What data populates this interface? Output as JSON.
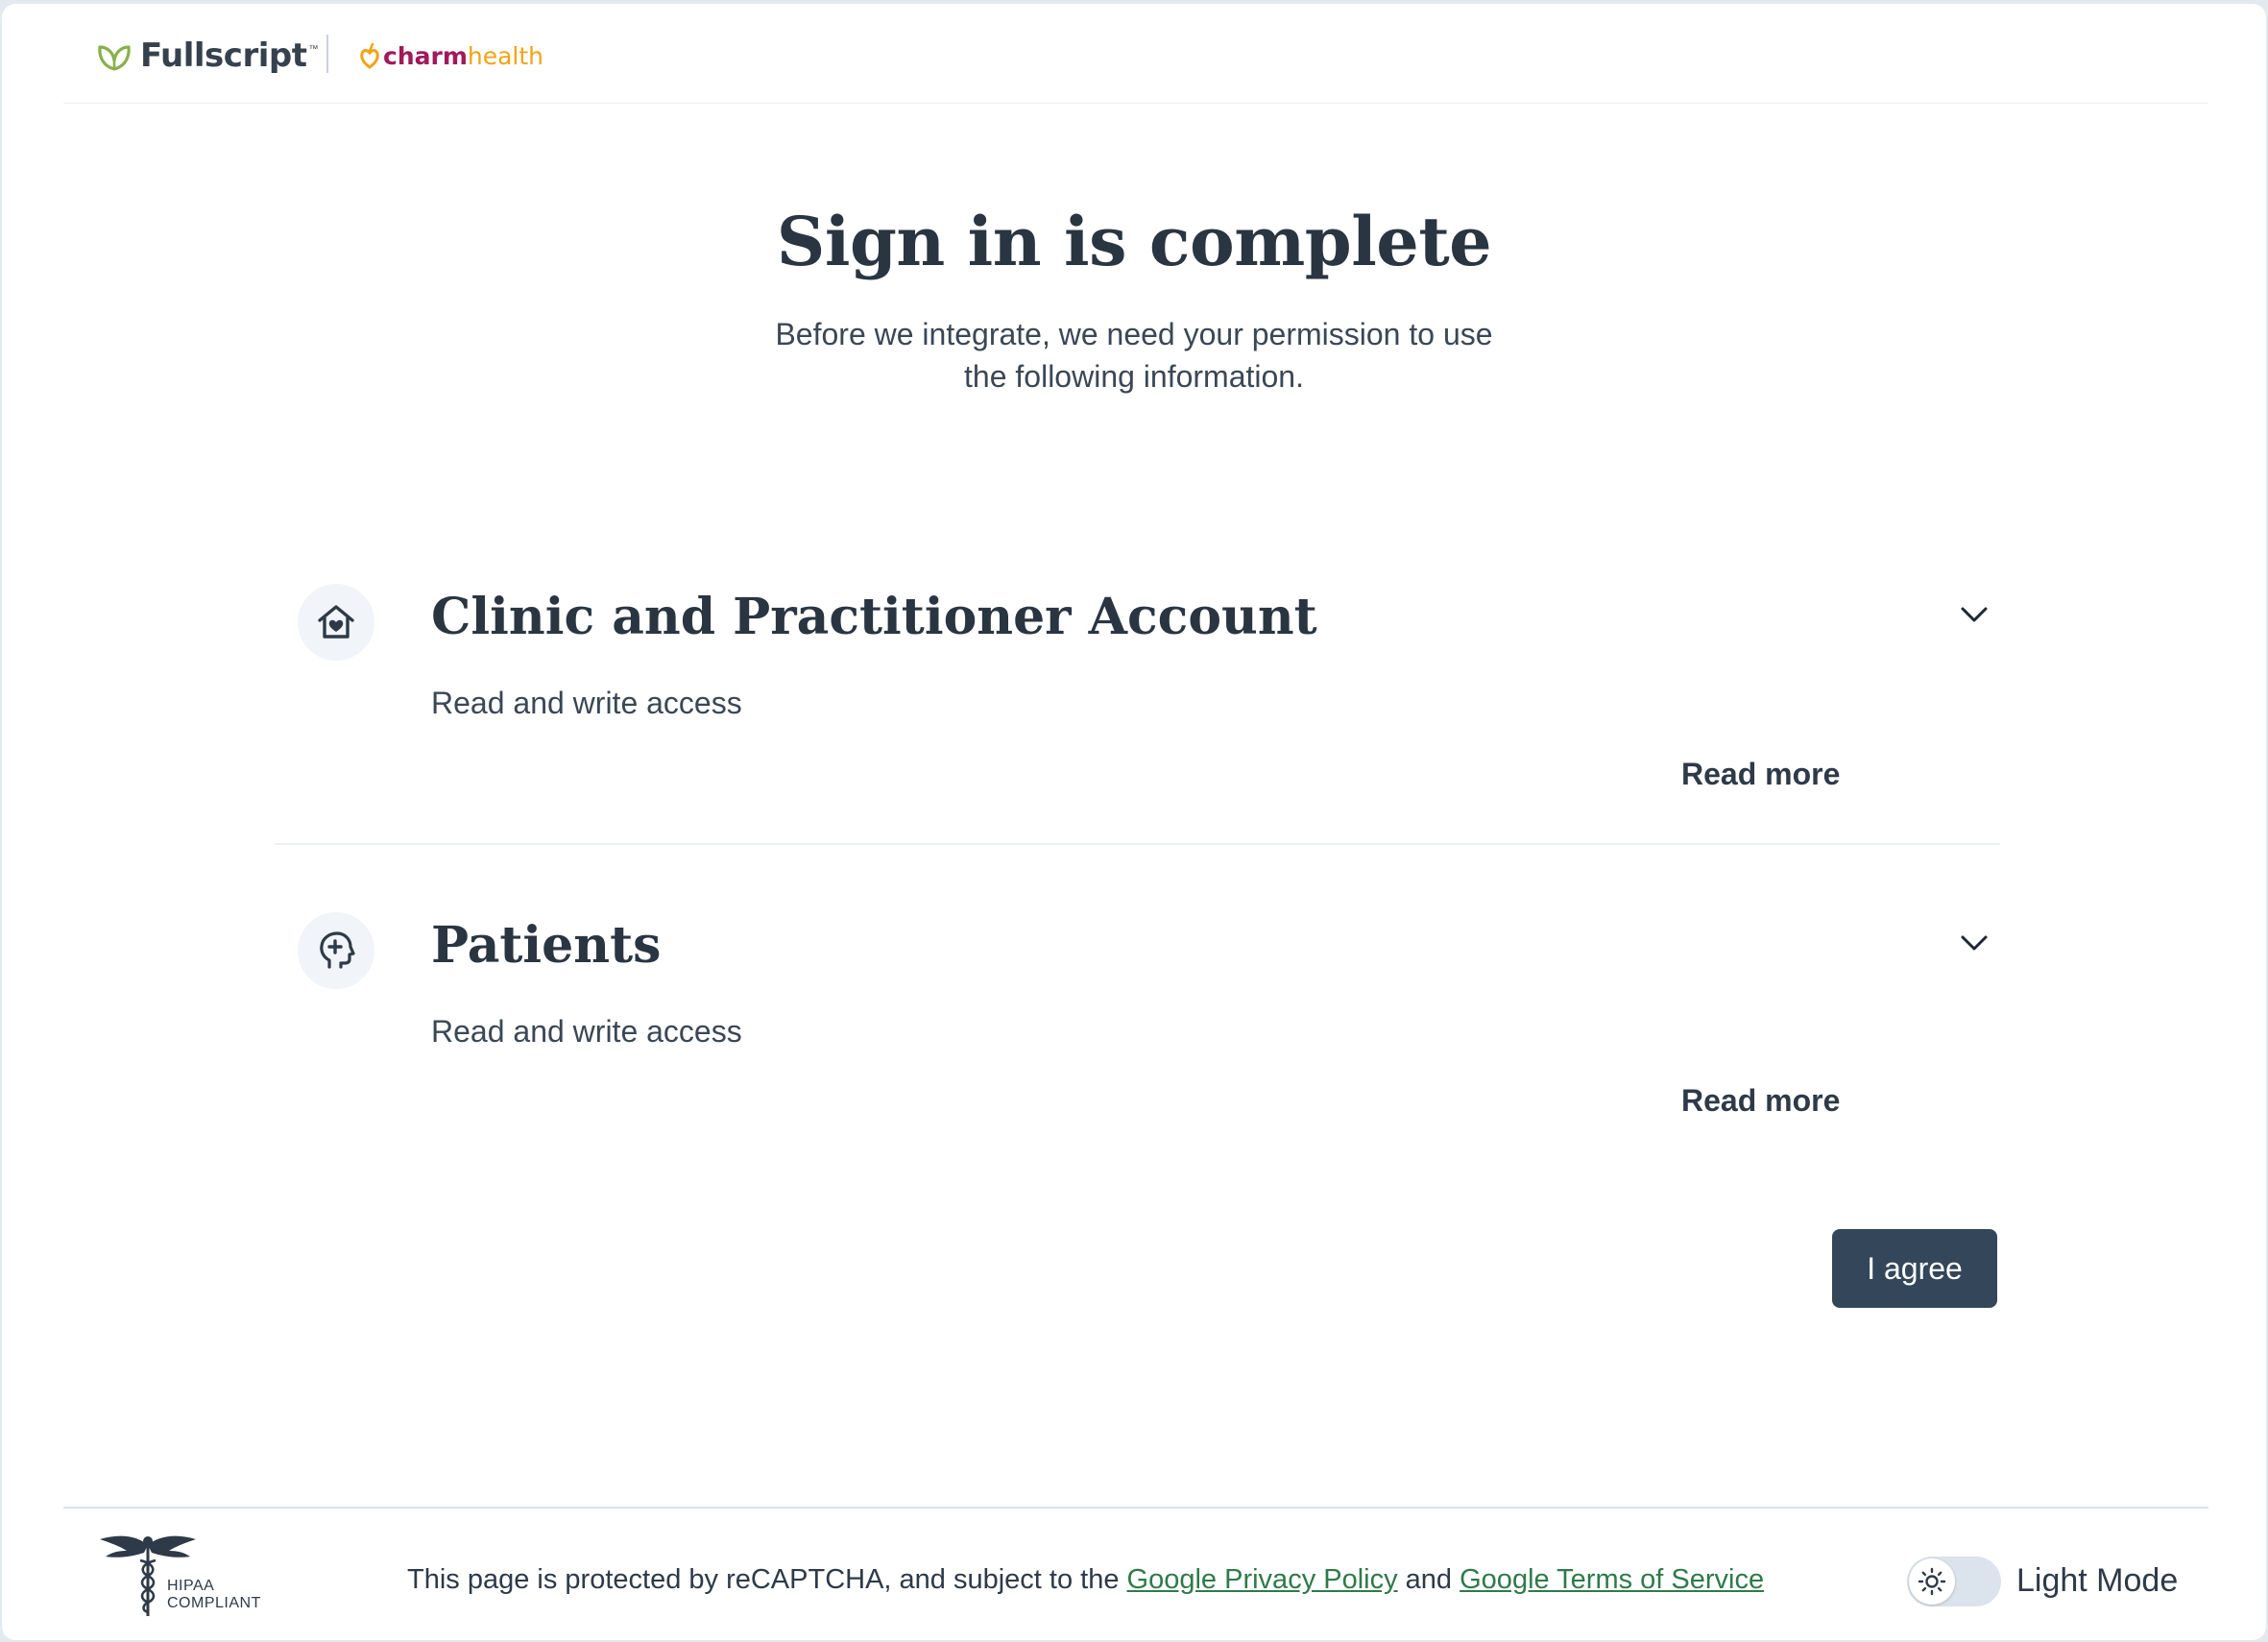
{
  "header": {
    "fullscript_name": "Fullscript",
    "fullscript_tm": "™",
    "charm_part1": "charm",
    "charm_part2": "health"
  },
  "main": {
    "title": "Sign in is complete",
    "subtitle_line1": "Before we integrate, we need your permission to use",
    "subtitle_line2": "the following information."
  },
  "permissions": [
    {
      "icon": "house-heart-icon",
      "title": "Clinic and Practitioner Account",
      "access": "Read and write access",
      "read_more": "Read more"
    },
    {
      "icon": "head-medical-icon",
      "title": "Patients",
      "access": "Read and write access",
      "read_more": "Read more"
    }
  ],
  "agree_label": "I agree",
  "footer": {
    "hipaa_line1": "HIPAA",
    "hipaa_line2": "COMPLIANT",
    "recaptcha_prefix": "This page is protected by reCAPTCHA, and subject to the",
    "privacy_link": "Google Privacy Policy",
    "and": "and",
    "terms_link": "Google Terms of Service",
    "mode_label": "Light Mode"
  },
  "colors": {
    "primary_button": "#34465a",
    "link_green": "#2f7a4a",
    "fullscript_leaf": "#88b04b",
    "charm_magenta": "#a2195b",
    "charm_orange": "#f3a317"
  }
}
